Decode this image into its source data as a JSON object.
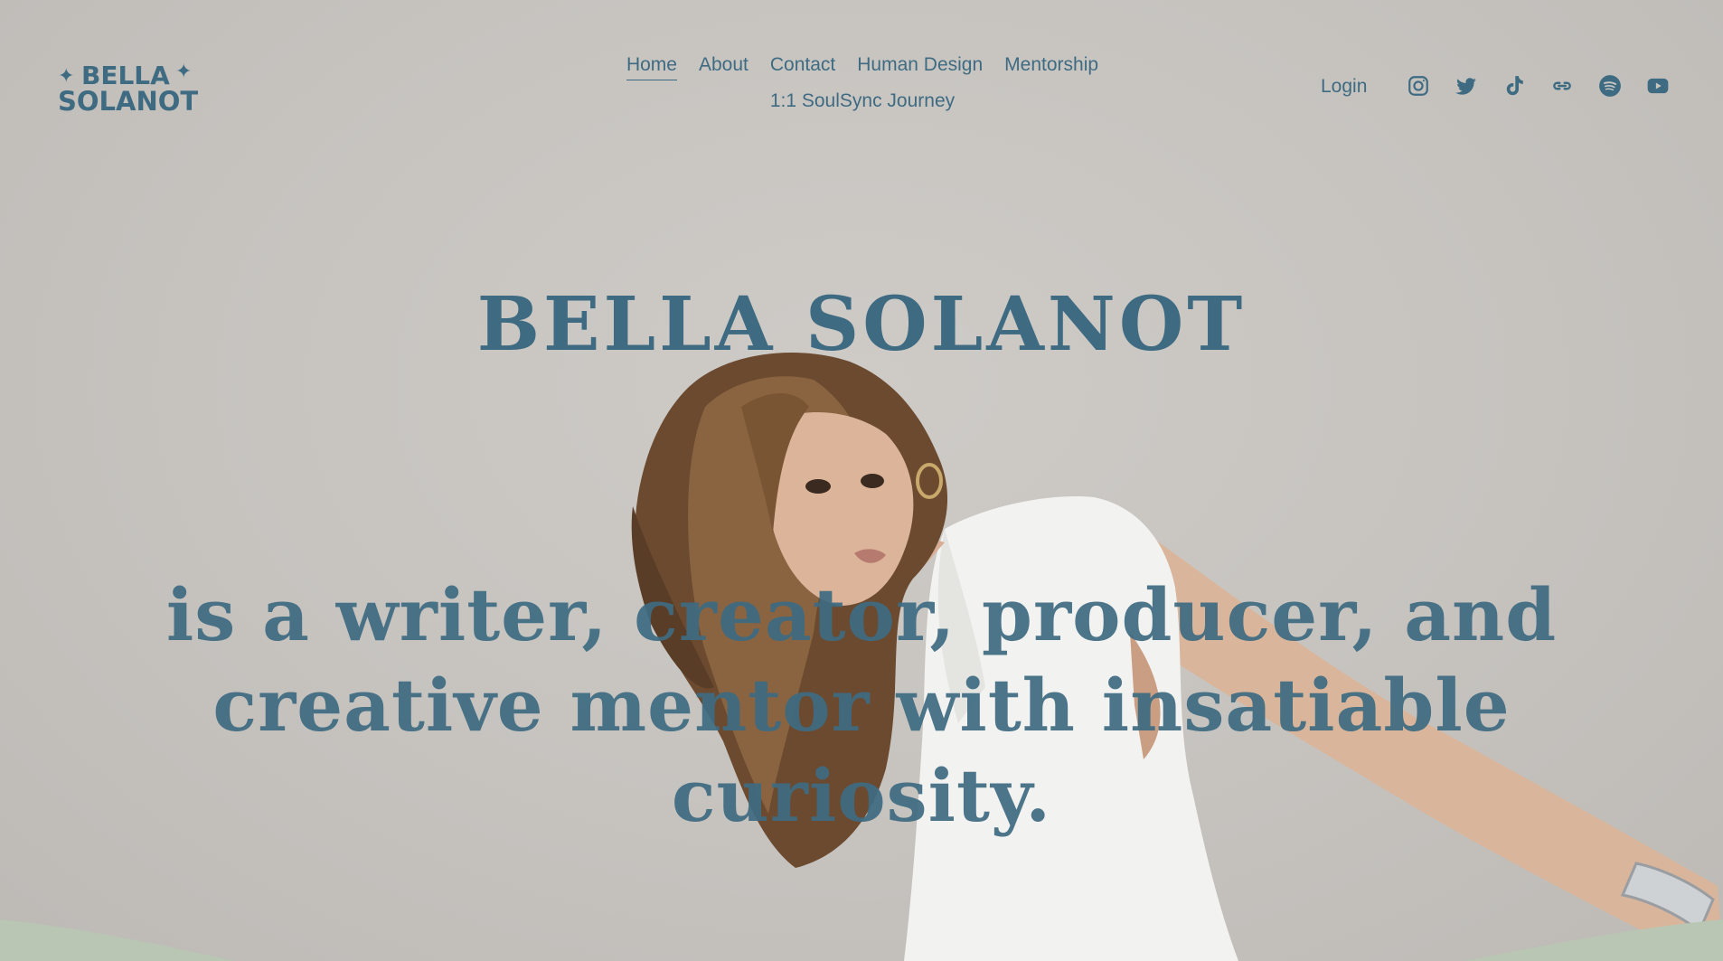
{
  "brand": {
    "logo_line1": "BELLA",
    "logo_line2": "SOLANOT"
  },
  "nav": {
    "items": [
      {
        "label": "Home",
        "active": true
      },
      {
        "label": "About"
      },
      {
        "label": "Contact"
      },
      {
        "label": "Human Design"
      },
      {
        "label": "Mentorship"
      },
      {
        "label": "1:1 SoulSync Journey"
      }
    ]
  },
  "header": {
    "login_label": "Login",
    "socials": [
      "instagram-icon",
      "twitter-icon",
      "tiktok-icon",
      "link-icon",
      "spotify-icon",
      "youtube-icon"
    ]
  },
  "hero": {
    "title": "BELLA SOLANOT",
    "subtitle": "is a writer, creator, producer, and creative mentor with insatiable curiosity."
  },
  "colors": {
    "accent": "#3e6b82",
    "background": "#c9c6c2",
    "footer_hill": "#b7c4b1"
  }
}
